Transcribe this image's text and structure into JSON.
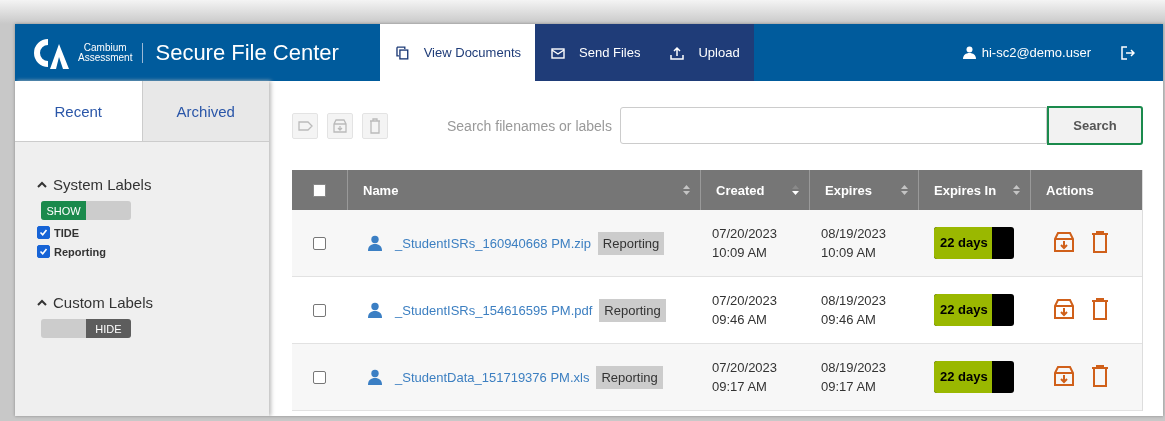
{
  "header": {
    "logo_line_1": "Cambium",
    "logo_line_2": "Assessment",
    "title": "Secure File Center",
    "nav": [
      {
        "label": "View Documents",
        "kind": "copy",
        "selected": true
      },
      {
        "label": "Send Files",
        "kind": "mail",
        "selected": false
      },
      {
        "label": "Upload",
        "kind": "upload",
        "selected": false
      }
    ],
    "user": "hi-sc2@demo.user"
  },
  "sidebar": {
    "tabs": [
      {
        "label": "Recent",
        "selected": true
      },
      {
        "label": "Archived",
        "selected": false
      }
    ],
    "label_groups": [
      {
        "title": "System Labels",
        "expanded": true,
        "toggle": {
          "label": "SHOW",
          "on": true
        },
        "items": [
          {
            "label": "TIDE",
            "checked": true
          },
          {
            "label": "Reporting",
            "checked": true
          }
        ]
      },
      {
        "title": "Custom Labels",
        "expanded": true,
        "toggle": {
          "label": "HIDE",
          "on": false
        }
      }
    ]
  },
  "toolbar": [
    {
      "kind": "tag",
      "disabled": true
    },
    {
      "kind": "archive",
      "disabled": true
    },
    {
      "kind": "delete",
      "disabled": true
    }
  ],
  "search": {
    "label": "Search filenames or labels",
    "button": "Search"
  },
  "table": {
    "select_all": {
      "checked": false
    },
    "columns": [
      {
        "label": "Name",
        "sortable": true,
        "sorted": false
      },
      {
        "label": "Created",
        "sortable": true,
        "sorted": true
      },
      {
        "label": "Expires",
        "sortable": true,
        "sorted": false
      },
      {
        "label": "Expires In",
        "sortable": true,
        "sorted": false
      },
      {
        "label": "Actions",
        "sortable": false
      }
    ],
    "rows": [
      {
        "checked": false,
        "name": "_StudentISRs_160940668 PM.zip",
        "label": "Reporting",
        "created": [
          "07/20/2023",
          "10:09 AM"
        ],
        "expires": [
          "08/19/2023",
          "10:09 AM"
        ],
        "expires_in": {
          "text": "22 days",
          "level": 0.73
        }
      },
      {
        "checked": false,
        "name": "_StudentISRs_154616595 PM.pdf",
        "label": "Reporting",
        "created": [
          "07/20/2023",
          "09:46 AM"
        ],
        "expires": [
          "08/19/2023",
          "09:46 AM"
        ],
        "expires_in": {
          "text": "22 days",
          "level": 0.73
        }
      },
      {
        "checked": false,
        "name": "_StudentData_151719376 PM.xls",
        "label": "Reporting",
        "created": [
          "07/20/2023",
          "09:17 AM"
        ],
        "expires": [
          "08/19/2023",
          "09:17 AM"
        ],
        "expires_in": {
          "text": "22 days",
          "level": 0.73
        }
      }
    ]
  }
}
